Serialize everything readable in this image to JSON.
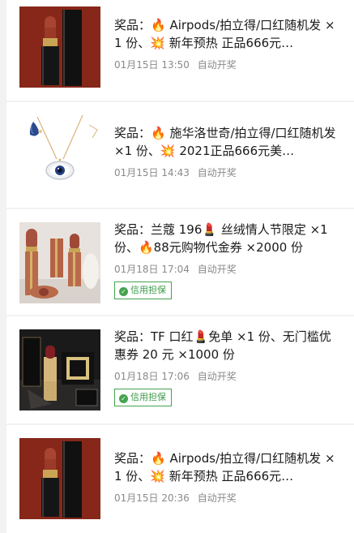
{
  "feed": {
    "items": [
      {
        "title": "奖品：🔥 Airpods/拍立得/口红随机发 ×1 份、💥 新年预热 正品666元…",
        "date": "01月15日 13:50",
        "status": "自动开奖",
        "image": "lipstick-image",
        "badge": ""
      },
      {
        "title": "奖品：🔥 施华洛世奇/拍立得/口红随机发 ×1 份、💥 2021正品666元美…",
        "date": "01月15日 14:43",
        "status": "自动开奖",
        "image": "necklace-image",
        "badge": ""
      },
      {
        "title": "奖品：兰蔻 196💄 丝绒情人节限定 ×1 份、🔥88元购物代金券 ×2000 份",
        "date": "01月18日 17:04",
        "status": "自动开奖",
        "image": "lipsticks-image",
        "badge": "信用担保"
      },
      {
        "title": "奖品：TF 口红💄免单 ×1 份、无门槛优惠券 20 元 ×1000 份",
        "date": "01月18日 17:06",
        "status": "自动开奖",
        "image": "tf-lipstick-image",
        "badge": "信用担保"
      },
      {
        "title": "奖品：🔥 Airpods/拍立得/口红随机发 ×1 份、💥 新年预热 正品666元…",
        "date": "01月15日 20:36",
        "status": "自动开奖",
        "image": "lipstick-image",
        "badge": ""
      }
    ]
  },
  "colors": {
    "background": "#f2f2f2",
    "card": "#ffffff",
    "title_text": "#1a1a1a",
    "meta_text": "#8a8a8a",
    "badge_green": "#44a34f",
    "lipstick_red": "#8c2a1c"
  }
}
